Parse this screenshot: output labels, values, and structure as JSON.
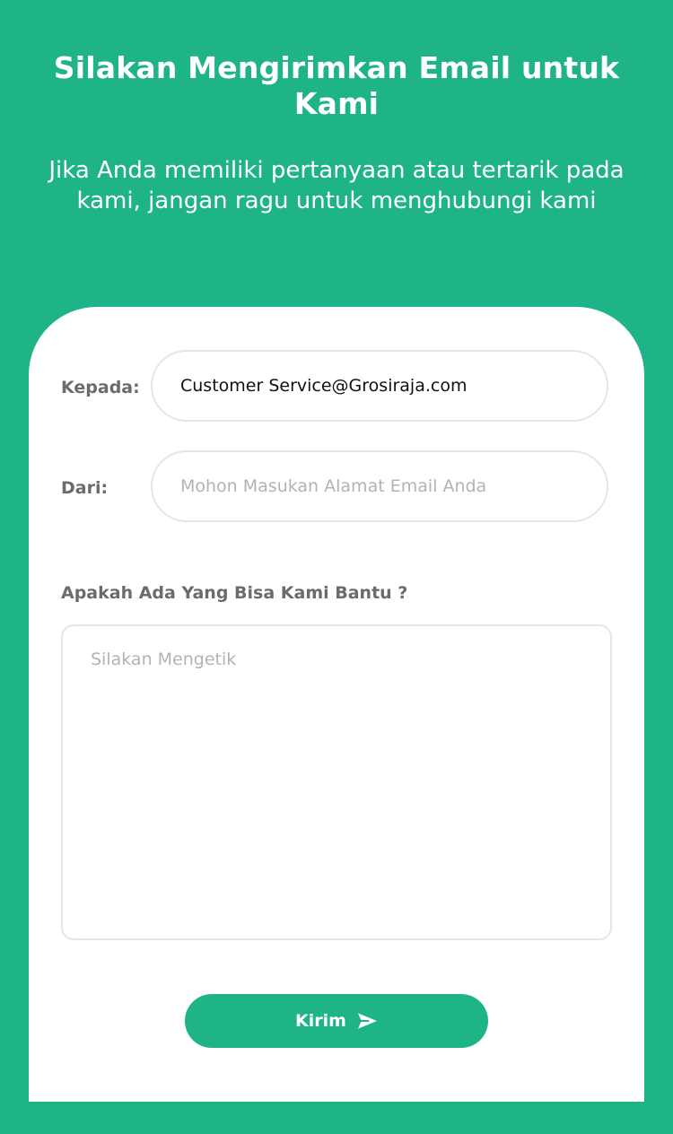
{
  "header": {
    "title": "Silakan Mengirimkan Email untuk Kami",
    "subtitle": "Jika Anda memiliki pertanyaan atau tertarik pada kami, jangan ragu untuk menghubungi kami"
  },
  "form": {
    "to_label": "Kepada:",
    "to_value": "Customer Service@Grosiraja.com",
    "from_label": "Dari:",
    "from_placeholder": "Mohon Masukan Alamat Email Anda",
    "question_label": "Apakah Ada Yang Bisa Kami Bantu ?",
    "message_placeholder": "Silakan Mengetik",
    "submit_label": "Kirim",
    "submit_icon": "send-icon"
  },
  "colors": {
    "brand": "#1fb488",
    "field_border": "#e3e4ee",
    "label": "#6b6b6b",
    "placeholder": "#b3b3b3"
  }
}
